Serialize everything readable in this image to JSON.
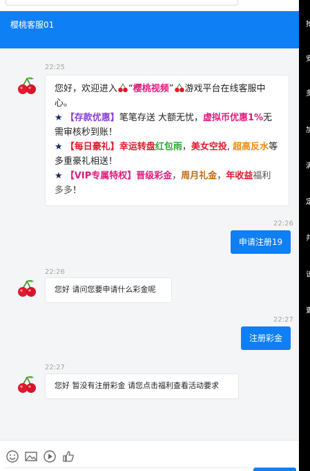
{
  "header": {
    "title": "樱桃客服01"
  },
  "messages": [
    {
      "time": "22:25",
      "greeting_line": [
        "您好，欢迎进入",
        "“",
        "樱桃视频",
        "”",
        "游戏平台在线客服中心。"
      ],
      "line1": [
        "★",
        "【存款优惠】",
        "笔笔存送 大额无忧，",
        "虚拟币优惠1%",
        "无需审核秒到账！"
      ],
      "line2": [
        "★",
        "【每日豪礼】",
        "幸运转盘",
        "红包雨",
        "，",
        "美女空投",
        ", ",
        "超高反水",
        "等多重豪礼相送！"
      ],
      "line3": [
        "★",
        "【VIP专属特权】",
        "晋级彩金",
        "，",
        "周月礼金",
        "，",
        "年收益",
        "福利多多",
        "！"
      ]
    },
    {
      "time": "22:26",
      "text": "申请注册19"
    },
    {
      "time": "22:26",
      "text": "您好 请问您要申请什么彩金呢"
    },
    {
      "time": "22:27",
      "text": "注册彩金"
    },
    {
      "time": "22:27",
      "text": "您好 暂没有注册彩金 请您点击福利查看活动要求"
    }
  ],
  "footer_icons": [
    "emoji-icon",
    "image-icon",
    "video-icon",
    "thumbs-up-icon"
  ],
  "side_panel": [
    "抢",
    "安",
    "多",
    "加",
    "满",
    "定",
    "共",
    "该",
    "更"
  ],
  "colors": {
    "brand_blue": "#0f7ff5",
    "chat_bg": "#f4f5f7"
  }
}
